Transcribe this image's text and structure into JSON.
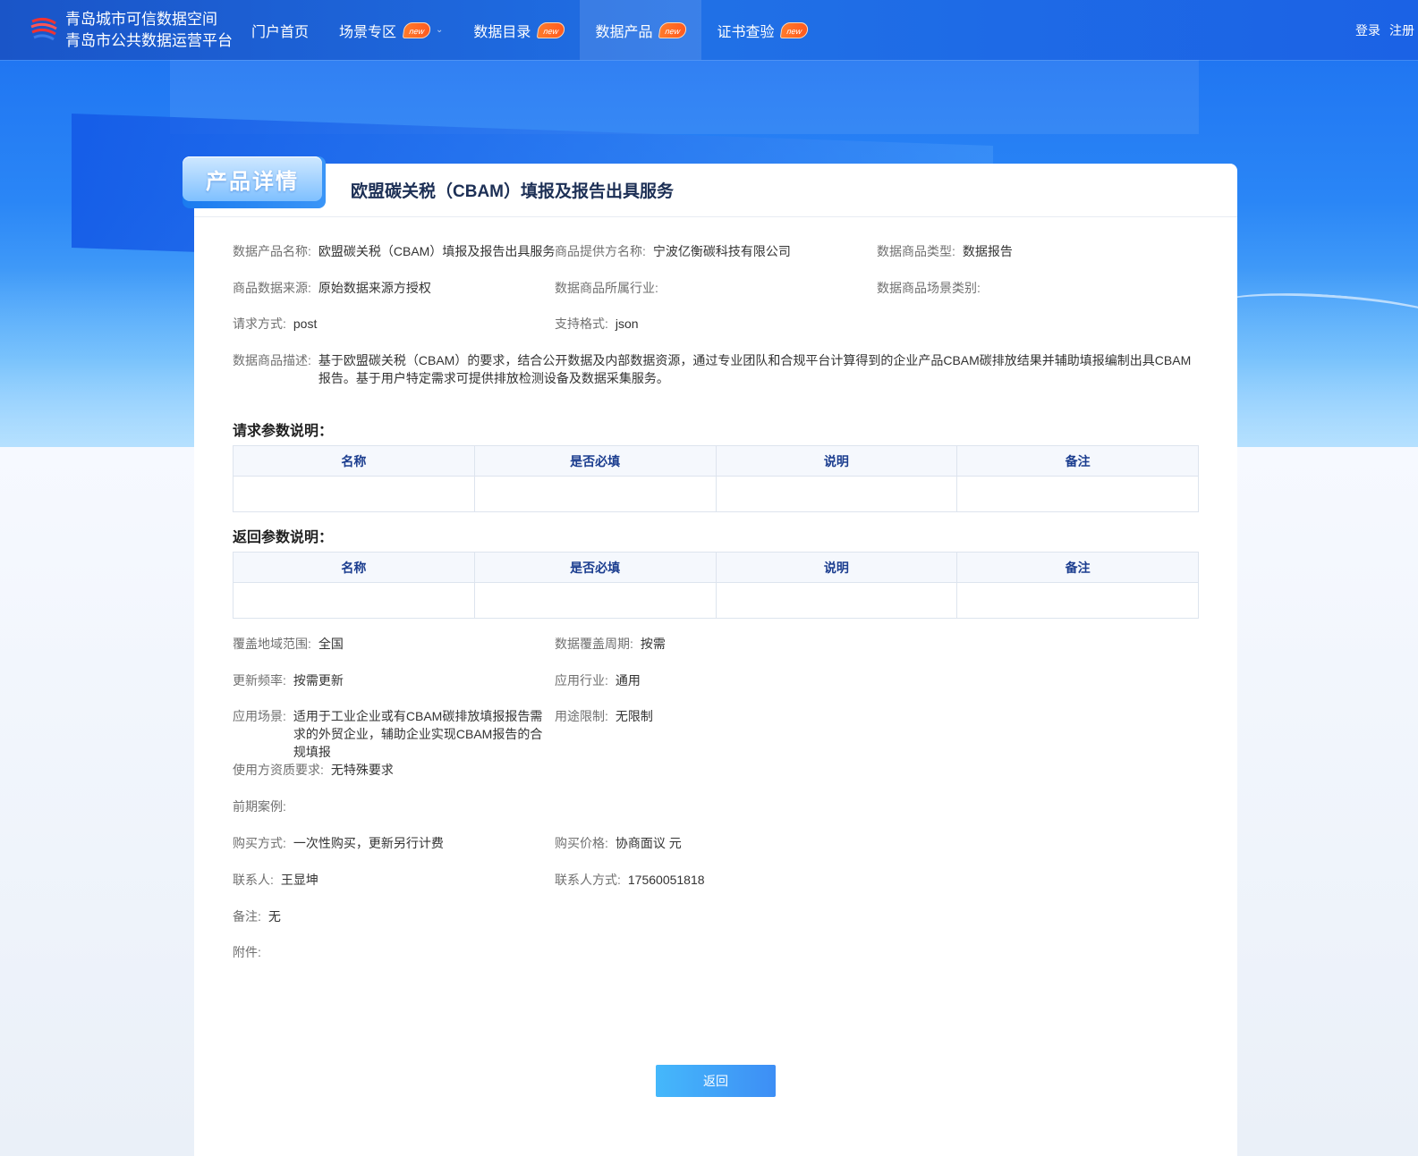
{
  "header": {
    "brand_line1": "青岛城市可信数据空间",
    "brand_line2": "青岛市公共数据运营平台",
    "nav": [
      {
        "label": "门户首页"
      },
      {
        "label": "场景专区",
        "badge": "new"
      },
      {
        "label": "数据目录",
        "badge": "new"
      },
      {
        "label": "数据产品",
        "badge": "new"
      },
      {
        "label": "证书查验",
        "badge": "new"
      }
    ],
    "login": "登录",
    "register": "注册"
  },
  "card": {
    "tab_label": "产品详情",
    "title": "欧盟碳关税（CBAM）填报及报告出具服务"
  },
  "fields": {
    "product_name": {
      "label": "数据产品名称:",
      "value": "欧盟碳关税（CBAM）填报及报告出具服务"
    },
    "provider": {
      "label": "商品提供方名称:",
      "value": "宁波亿衡碳科技有限公司"
    },
    "type": {
      "label": "数据商品类型:",
      "value": "数据报告"
    },
    "source": {
      "label": "商品数据来源:",
      "value": "原始数据来源方授权"
    },
    "industry": {
      "label": "数据商品所属行业:",
      "value": ""
    },
    "scene_category": {
      "label": "数据商品场景类别:",
      "value": ""
    },
    "request_method": {
      "label": "请求方式:",
      "value": "post"
    },
    "format": {
      "label": "支持格式:",
      "value": "json"
    },
    "description": {
      "label": "数据商品描述:",
      "value": "基于欧盟碳关税（CBAM）的要求，结合公开数据及内部数据资源，通过专业团队和合规平台计算得到的企业产品CBAM碳排放结果并辅助填报编制出具CBAM报告。基于用户特定需求可提供排放检测设备及数据采集服务。"
    },
    "coverage_area": {
      "label": "覆盖地域范围:",
      "value": "全国"
    },
    "coverage_period": {
      "label": "数据覆盖周期:",
      "value": "按需"
    },
    "update_freq": {
      "label": "更新频率:",
      "value": "按需更新"
    },
    "app_industry": {
      "label": "应用行业:",
      "value": "通用"
    },
    "app_scene": {
      "label": "应用场景:",
      "value": "适用于工业企业或有CBAM碳排放填报报告需求的外贸企业，辅助企业实现CBAM报告的合规填报"
    },
    "usage_limit": {
      "label": "用途限制:",
      "value": "无限制"
    },
    "qualification": {
      "label": "使用方资质要求:",
      "value": "无特殊要求"
    },
    "cases": {
      "label": "前期案例:",
      "value": ""
    },
    "purchase_method": {
      "label": "购买方式:",
      "value": "一次性购买，更新另行计费"
    },
    "price": {
      "label": "购买价格:",
      "value": "协商面议 元"
    },
    "contact": {
      "label": "联系人:",
      "value": "王显坤"
    },
    "contact_phone": {
      "label": "联系人方式:",
      "value": "17560051818"
    },
    "remark": {
      "label": "备注:",
      "value": "无"
    },
    "attachment": {
      "label": "附件:",
      "value": ""
    }
  },
  "request_params": {
    "title": "请求参数说明：",
    "columns": [
      "名称",
      "是否必填",
      "说明",
      "备注"
    ]
  },
  "response_params": {
    "title": "返回参数说明：",
    "columns": [
      "名称",
      "是否必填",
      "说明",
      "备注"
    ]
  },
  "back_button": "返回",
  "colors": {
    "primary": "#2070e6",
    "badge": "#ff6a24",
    "table_header_text": "#1b3d8f"
  }
}
